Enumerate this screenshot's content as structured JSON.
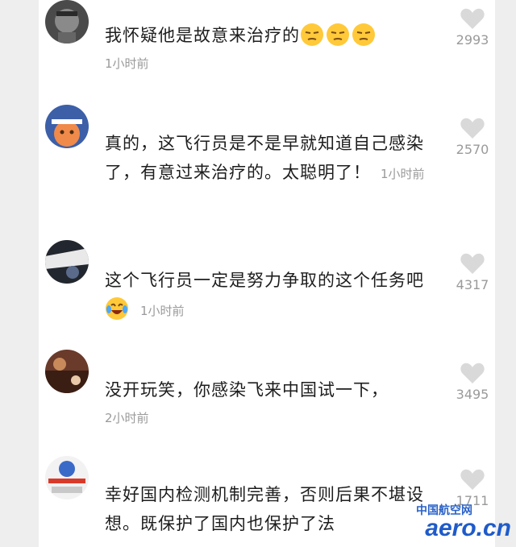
{
  "comments": [
    {
      "text": "我怀疑他是故意来治疗的",
      "emojis": [
        "smirk-face",
        "smirk-face",
        "smirk-face"
      ],
      "time": "1小时前",
      "likes": "2993"
    },
    {
      "text": "真的，这飞行员是不是早就知道自己感染了，有意过来治疗的。太聪明了！",
      "emojis": [],
      "time": "1小时前",
      "likes": "2570"
    },
    {
      "text": "这个飞行员一定是努力争取的这个任务吧",
      "emojis": [
        "laugh-cry-face"
      ],
      "time": "1小时前",
      "likes": "4317"
    },
    {
      "text": "没开玩笑，你感染飞来中国试一下，",
      "emojis": [],
      "time": "2小时前",
      "likes": "3495"
    },
    {
      "text": "幸好国内检测机制完善，否则后果不堪设想。既保护了国内也保护了法",
      "emojis": [],
      "time": "",
      "likes": "1711"
    }
  ],
  "watermark": {
    "site_cn": "中国航空网",
    "site_domain": "aero.cn"
  },
  "colors": {
    "text": "#1d1d1d",
    "muted": "#9a9a9a",
    "heart": "#d9d9d9",
    "watermark": "#1f5bc9"
  }
}
